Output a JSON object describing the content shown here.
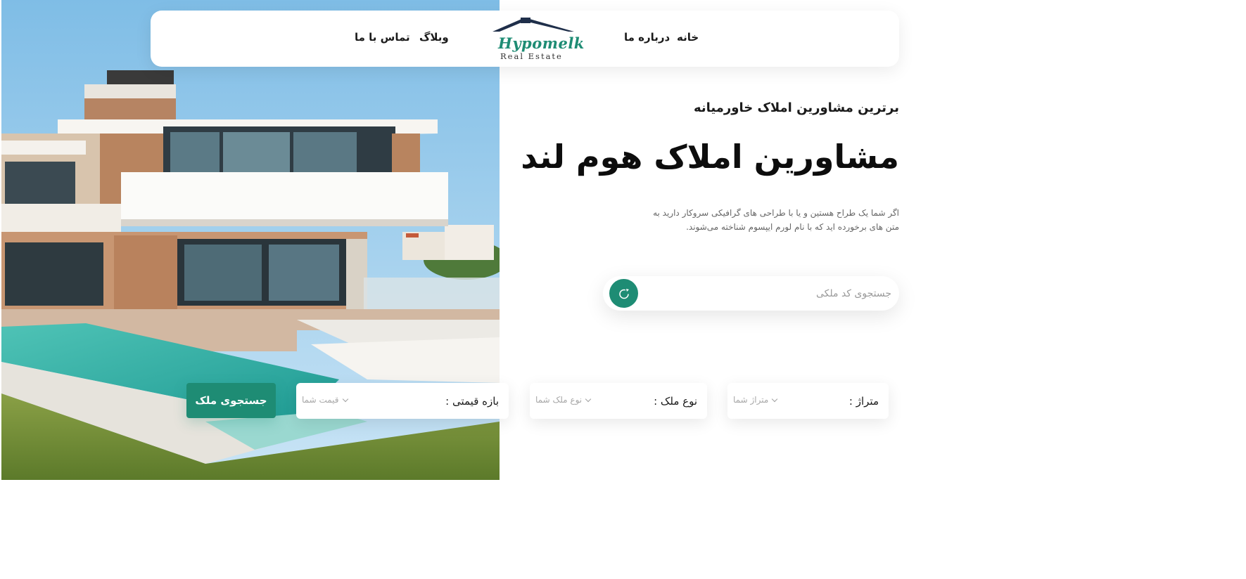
{
  "brand": {
    "name": "Hypomelk",
    "tagline": "Real Estate",
    "accent_color": "#1e8c74"
  },
  "nav": {
    "items": [
      {
        "label": "خانه"
      },
      {
        "label": "درباره ما"
      },
      {
        "label": "وبلاگ"
      },
      {
        "label": "تماس با ما"
      }
    ]
  },
  "hero": {
    "subtitle": "برترین مشاورین املاک خاورمیانه",
    "headline": "مشاورین املاک هوم لند",
    "description": "اگر شما یک طراح هستین و یا با طراحی های گرافیکی سروکار دارید به متن های برخورده اید که با نام لورم ایپسوم شناخته می‌شوند.",
    "photo_icon": "modern-villa-with-pool-image"
  },
  "search": {
    "placeholder": "جستجوی کد ملکی",
    "button_icon": "search-refresh-icon"
  },
  "filters": {
    "area": {
      "label": "متراژ :",
      "placeholder": "متراژ شما"
    },
    "property_type": {
      "label": "نوع ملک :",
      "placeholder": "نوع ملک شما"
    },
    "price_range": {
      "label": "بازه قیمتی :",
      "placeholder": "قیمت شما"
    },
    "submit_label": "جستجوی ملک"
  }
}
